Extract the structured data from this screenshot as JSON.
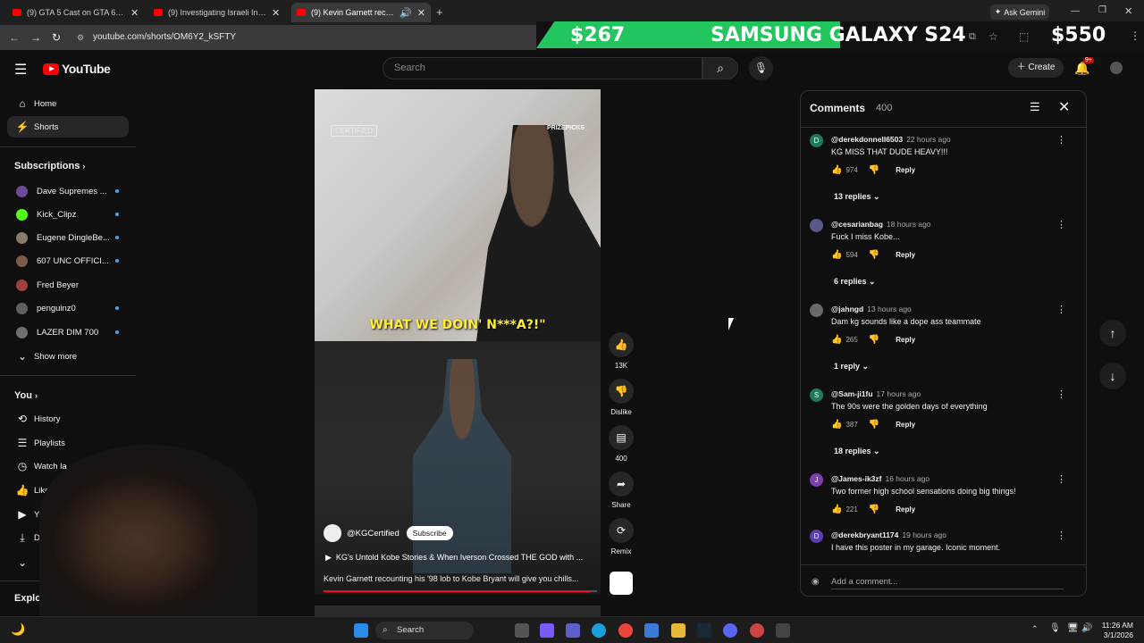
{
  "browser": {
    "tabs": [
      {
        "title": "(9) GTA 5 Cast on GTA 6 or Red"
      },
      {
        "title": "(9) Investigating Israeli Influence"
      },
      {
        "title": "(9) Kevin Garnett recounting"
      }
    ],
    "url": "youtube.com/shorts/OM6Y2_kSFTY",
    "gemini_label": "Ask Gemini"
  },
  "banner": {
    "price_left": "$267",
    "product": "SAMSUNG GALAXY S24",
    "price_right": "$550"
  },
  "youtube": {
    "logo_text": "YouTube",
    "search_placeholder": "Search",
    "create_label": "Create",
    "notif_badge": "9+"
  },
  "sidebar": {
    "main": [
      {
        "label": "Home",
        "icon": "home-icon"
      },
      {
        "label": "Shorts",
        "icon": "shorts-icon"
      }
    ],
    "subscriptions_label": "Subscriptions",
    "subscriptions": [
      {
        "label": "Dave Supremes ...",
        "color": "#6b4c9a"
      },
      {
        "label": "Kick_Clipz",
        "color": "#53fc18"
      },
      {
        "label": "Eugene DingleBe...",
        "color": "#8a7a6a"
      },
      {
        "label": "607 UNC OFFICI...",
        "color": "#7a5a4a"
      },
      {
        "label": "Fred Beyer",
        "color": "#a04040"
      },
      {
        "label": "penguinz0",
        "color": "#606060"
      },
      {
        "label": "LAZER DIM 700",
        "color": "#707070"
      }
    ],
    "show_more": "Show more",
    "you_label": "You",
    "you_items": [
      {
        "label": "History",
        "icon": "history-icon"
      },
      {
        "label": "Playlists",
        "icon": "playlists-icon"
      },
      {
        "label": "Watch la",
        "icon": "watch-later-icon"
      },
      {
        "label": "Liked",
        "icon": "liked-icon"
      },
      {
        "label": "You",
        "icon": "your-videos-icon"
      },
      {
        "label": "Do",
        "icon": "downloads-icon"
      }
    ],
    "explore_label": "Explor"
  },
  "short": {
    "watermark": "CERTIFIED",
    "sponsor": "PRIZEPICKS",
    "caption": "WHAT WE DOIN' N***A?!\"",
    "channel": "@KGCertified",
    "subscribe": "Subscribe",
    "title": "KG's Untold Kobe Stories & When Iverson Crossed THE GOD with ...",
    "description": "Kevin Garnett recounting his '98 lob to Kobe Bryant will give you chills...",
    "progress": 0.97
  },
  "actions": {
    "likes": "13K",
    "dislike": "Dislike",
    "comments": "400",
    "share": "Share",
    "remix": "Remix"
  },
  "comments": {
    "title": "Comments",
    "count": "400",
    "add_placeholder": "Add a comment...",
    "reply_label": "Reply",
    "items": [
      {
        "user": "@derekdonnell6503",
        "time": "22 hours ago",
        "text": "KG MISS THAT DUDE HEAVY!!!",
        "likes": "974",
        "replies": "13 replies",
        "initial": "D",
        "color": "#1e7a5a"
      },
      {
        "user": "@cesarianbag",
        "time": "18 hours ago",
        "text": "Fuck I miss Kobe...",
        "likes": "594",
        "replies": "6 replies",
        "initial": "",
        "color": "#5a5a8a"
      },
      {
        "user": "@jahngd",
        "time": "13 hours ago",
        "text": "Dam kg sounds like a dope ass teammate",
        "likes": "265",
        "replies": "1 reply",
        "initial": "",
        "color": "#6a6a6a"
      },
      {
        "user": "@Sam-ji1fu",
        "time": "17 hours ago",
        "text": "The 90s were the golden days of everything",
        "likes": "387",
        "replies": "18 replies",
        "initial": "S",
        "color": "#1e7a5a"
      },
      {
        "user": "@James-ik3zf",
        "time": "16 hours ago",
        "text": "Two former high school sensations doing big things!",
        "likes": "221",
        "replies": "",
        "initial": "J",
        "color": "#7b3fb0"
      },
      {
        "user": "@derekbryant1174",
        "time": "19 hours ago",
        "text": "I have this poster in my garage. Iconic moment.",
        "likes": "",
        "replies": "",
        "initial": "D",
        "color": "#5b3fb0"
      }
    ]
  },
  "taskbar": {
    "search": "Search",
    "time": "11:26 AM",
    "date": "3/1/2026"
  }
}
